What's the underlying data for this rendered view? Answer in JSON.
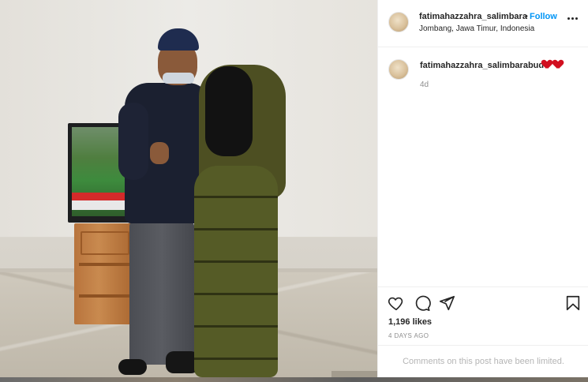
{
  "post": {
    "username": "fatimahazzahra_salimbara",
    "separator": "•",
    "follow_label": "Follow",
    "location": "Jombang, Jawa Timur, Indonesia"
  },
  "caption": {
    "username": "fatimahazzahra_salimbarabud",
    "emoji": "heart-emoji x2",
    "time": "4d"
  },
  "actions": {
    "icons": [
      "heart-icon",
      "comment-icon",
      "share-icon",
      "bookmark-icon"
    ]
  },
  "stats": {
    "likes": "1,196 likes",
    "date": "4 DAYS AGO"
  },
  "comments": {
    "limited_text": "Comments on this post have been limited."
  },
  "colors": {
    "follow": "#0095f6",
    "heart": "#d10f1f",
    "muted": "#8e8e8e"
  }
}
